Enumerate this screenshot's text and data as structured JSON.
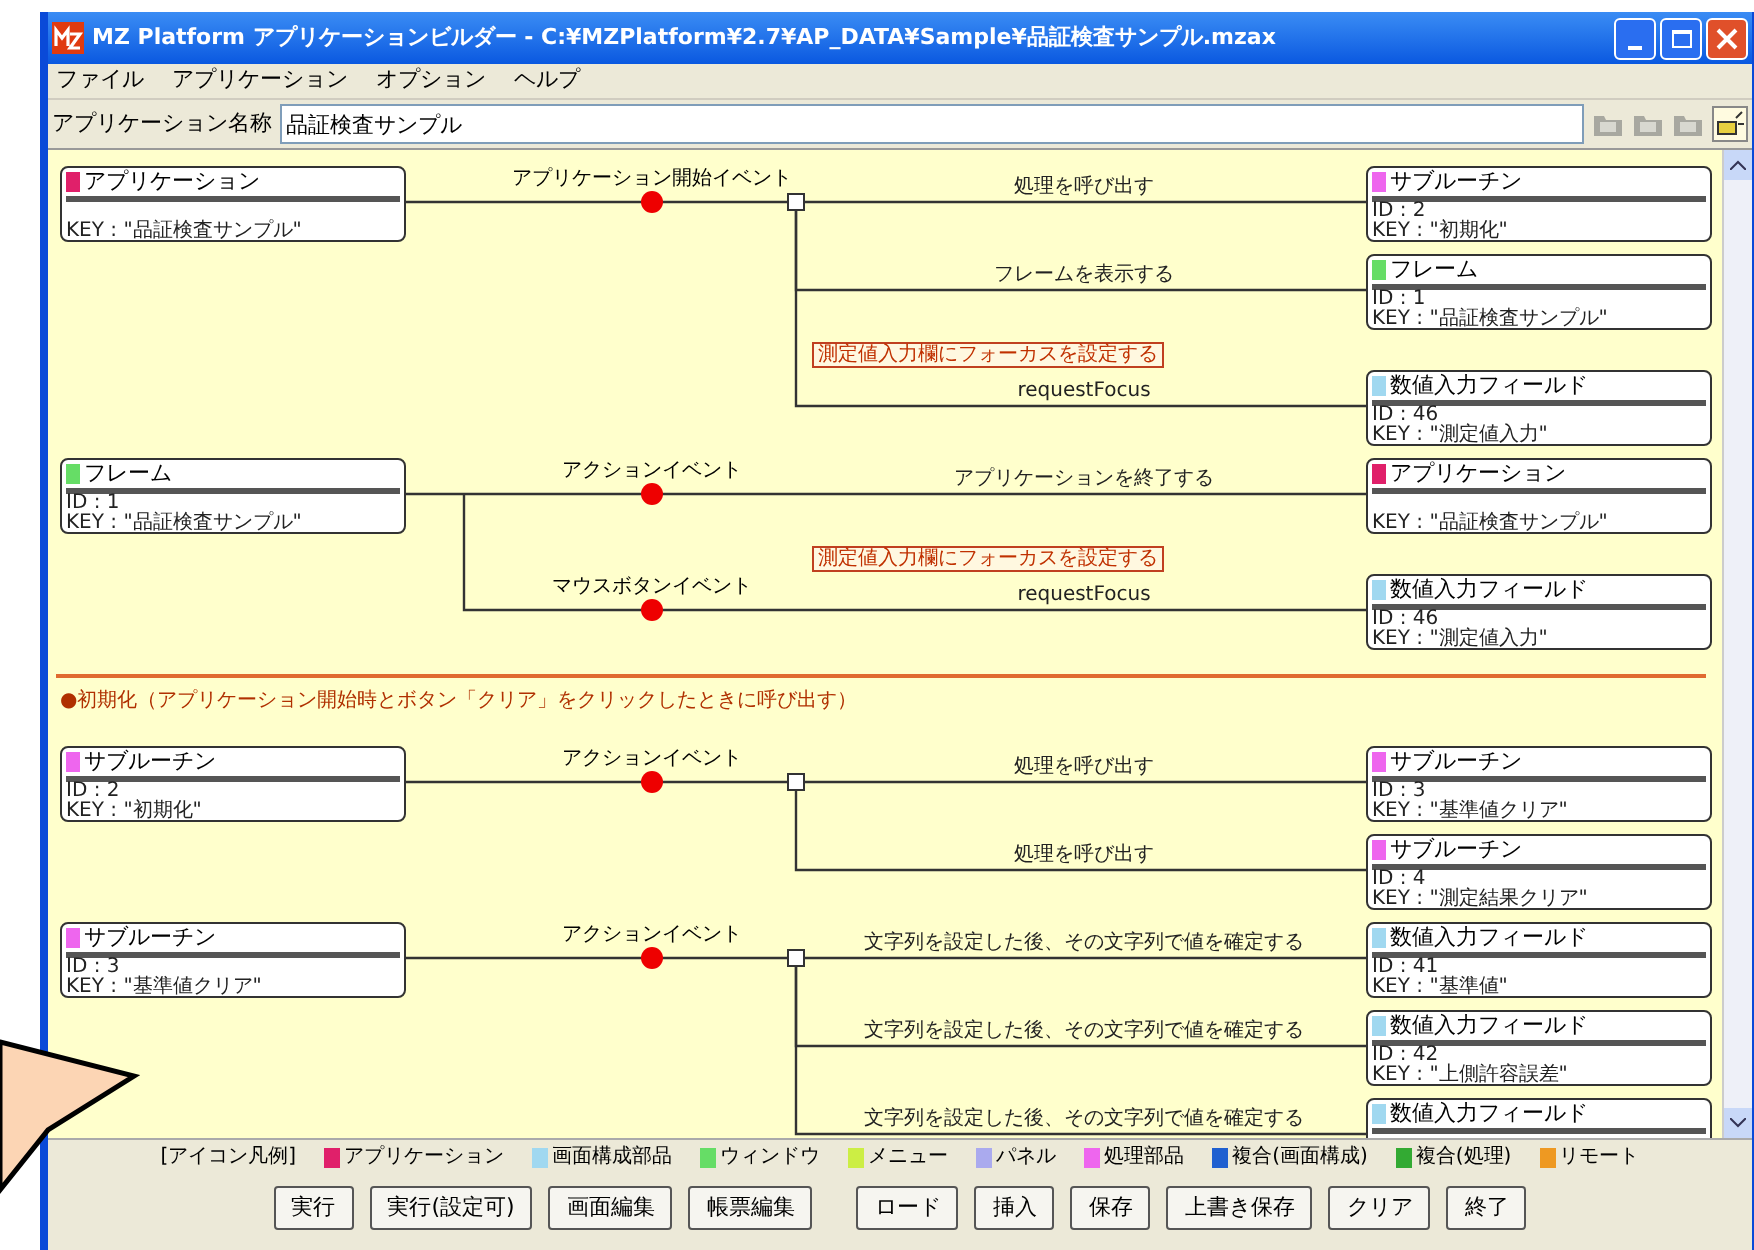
{
  "window": {
    "title": "MZ Platform アプリケーションビルダー - C:¥MZPlatform¥2.7¥AP_DATA¥Sample¥品証検査サンプル.mzax"
  },
  "menu": [
    "ファイル",
    "アプリケーション",
    "オプション",
    "ヘルプ"
  ],
  "app_name": {
    "label": "アプリケーション名称",
    "value": "品証検査サンプル"
  },
  "blocks": [
    {
      "kind": "group",
      "source": {
        "kind": "application",
        "title": "アプリケーション",
        "key": "KEY : \"品証検査サンプル\""
      },
      "events": [
        {
          "label": "アプリケーション開始イベント",
          "links": [
            {
              "action": "処理を呼び出す",
              "target": {
                "kind": "subroutine",
                "title": "サブルーチン",
                "id": "ID : 2",
                "key": "KEY : \"初期化\""
              }
            },
            {
              "action": "フレームを表示する",
              "target": {
                "kind": "frame",
                "title": "フレーム",
                "id": "ID : 1",
                "key": "KEY : \"品証検査サンプル\""
              }
            },
            {
              "note": "測定値入力欄にフォーカスを設定する",
              "action": "requestFocus",
              "target": {
                "kind": "field",
                "title": "数値入力フィールド",
                "id": "ID : 46",
                "key": "KEY : \"測定値入力\""
              }
            }
          ]
        }
      ]
    },
    {
      "kind": "group",
      "source": {
        "kind": "frame",
        "title": "フレーム",
        "id": "ID : 1",
        "key": "KEY : \"品証検査サンプル\""
      },
      "events": [
        {
          "label": "アクションイベント",
          "links": [
            {
              "action": "アプリケーションを終了する",
              "target": {
                "kind": "application",
                "title": "アプリケーション",
                "key": "KEY : \"品証検査サンプル\""
              }
            }
          ]
        },
        {
          "label": "マウスボタンイベント",
          "links": [
            {
              "note": "測定値入力欄にフォーカスを設定する",
              "action": "requestFocus",
              "target": {
                "kind": "field",
                "title": "数値入力フィールド",
                "id": "ID : 46",
                "key": "KEY : \"測定値入力\""
              }
            }
          ]
        }
      ]
    },
    {
      "kind": "section",
      "title": "●初期化（アプリケーション開始時とボタン「クリア」をクリックしたときに呼び出す）"
    },
    {
      "kind": "group",
      "source": {
        "kind": "subroutine",
        "title": "サブルーチン",
        "id": "ID : 2",
        "key": "KEY : \"初期化\""
      },
      "events": [
        {
          "label": "アクションイベント",
          "links": [
            {
              "action": "処理を呼び出す",
              "target": {
                "kind": "subroutine",
                "title": "サブルーチン",
                "id": "ID : 3",
                "key": "KEY : \"基準値クリア\""
              }
            },
            {
              "action": "処理を呼び出す",
              "target": {
                "kind": "subroutine",
                "title": "サブルーチン",
                "id": "ID : 4",
                "key": "KEY : \"測定結果クリア\""
              }
            }
          ]
        }
      ]
    },
    {
      "kind": "group",
      "source": {
        "kind": "subroutine",
        "title": "サブルーチン",
        "id": "ID : 3",
        "key": "KEY : \"基準値クリア\""
      },
      "events": [
        {
          "label": "アクションイベント",
          "links": [
            {
              "action": "文字列を設定した後、その文字列で値を確定する",
              "target": {
                "kind": "field",
                "title": "数値入力フィールド",
                "id": "ID : 41",
                "key": "KEY : \"基準値\""
              }
            },
            {
              "action": "文字列を設定した後、その文字列で値を確定する",
              "target": {
                "kind": "field",
                "title": "数値入力フィールド",
                "id": "ID : 42",
                "key": "KEY : \"上側許容誤差\""
              }
            },
            {
              "action": "文字列を設定した後、その文字列で値を確定する",
              "target": {
                "kind": "field",
                "title": "数値入力フィールド"
              }
            }
          ]
        }
      ]
    }
  ],
  "legend": {
    "label": "[アイコン凡例]",
    "items": [
      {
        "label": "アプリケーション",
        "color": "#e0206a"
      },
      {
        "label": "画面構成部品",
        "color": "#a0d8f0"
      },
      {
        "label": "ウィンドウ",
        "color": "#66dd66"
      },
      {
        "label": "メニュー",
        "color": "#ccee44"
      },
      {
        "label": "パネル",
        "color": "#aaaaee"
      },
      {
        "label": "処理部品",
        "color": "#ee66ee"
      },
      {
        "label": "複合(画面構成)",
        "color": "#2060d0"
      },
      {
        "label": "複合(処理)",
        "color": "#33aa33"
      },
      {
        "label": "リモート",
        "color": "#ee9922"
      }
    ]
  },
  "button_groups": [
    [
      "実行",
      "実行(設定可)",
      "画面編集",
      "帳票編集"
    ],
    [
      "ロード",
      "挿入",
      "保存",
      "上書き保存",
      "クリア",
      "終了"
    ]
  ]
}
